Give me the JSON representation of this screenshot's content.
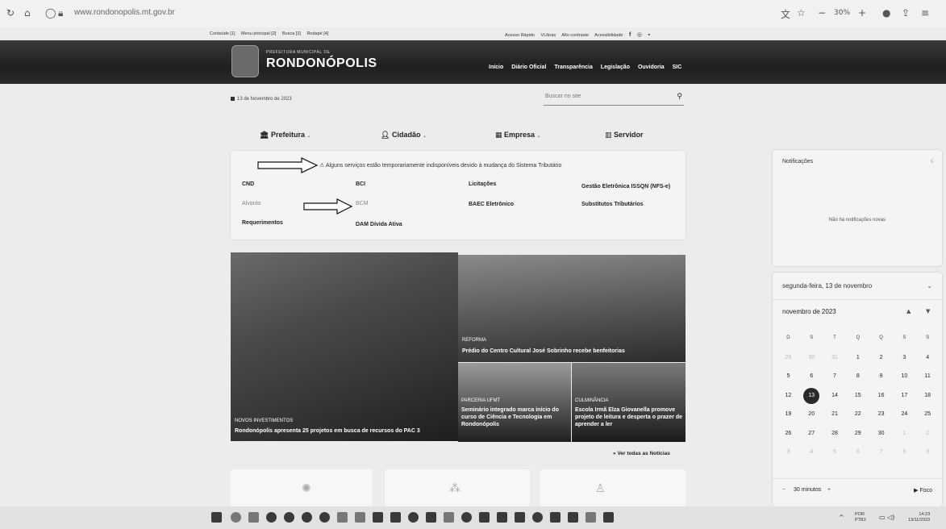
{
  "browser": {
    "url": "www.rondonopolis.mt.gov.br",
    "zoom": "30%",
    "minus": "−",
    "plus": "+"
  },
  "top_links": {
    "skip": [
      "Conteúdo [1]",
      "Menu principal [2]",
      "Busca [3]",
      "Rodapé [4]"
    ],
    "access": [
      "Acesso Rápido",
      "VLibras",
      "Alto contraste",
      "Acessibilidade"
    ]
  },
  "header": {
    "prefeitura_label": "PREFEITURA MUNICIPAL DE",
    "city_name": "RONDONÓPOLIS",
    "nav": [
      "Início",
      "Diário Oficial",
      "Transparência",
      "Legislação",
      "Ouvidoria",
      "SIC"
    ]
  },
  "date_text": "13 de Novembro de 2023",
  "search": {
    "placeholder": "Buscar no site"
  },
  "categories": [
    "Prefeitura",
    "Cidadão",
    "Empresa",
    "Servidor"
  ],
  "services": {
    "notice": "Alguns serviços estão temporariamente indisponíveis devido à mudança do Sistema Tributário",
    "items": [
      "CND",
      "BCI",
      "Licitações",
      "Gestão Eletrônica ISSQN (NFS-e)",
      "Alvarás",
      "BCM",
      "BAEC Eletrônico",
      "Substitutos Tributários",
      "Requerimentos",
      "DAM Dívida Ativa"
    ]
  },
  "news": [
    {
      "tag": "NOVOS INVESTIMENTOS",
      "headline": "Rondonópolis apresenta 25 projetos em busca de recursos do PAC 3"
    },
    {
      "tag": "REFORMA",
      "headline": "Prédio do Centro Cultural José Sobrinho recebe benfeitorias"
    },
    {
      "tag": "PARCERIA UFMT",
      "headline": "Seminário integrado marca início do curso de Ciência e Tecnologia em Rondonópolis"
    },
    {
      "tag": "CULMINÂNCIA",
      "headline": "Escola Irmã Elza Giovanella promove projeto de leitura e desperta o prazer de aprender a ler"
    }
  ],
  "see_all": "Ver todas as Notícias",
  "notifications": {
    "title": "Notificações",
    "empty": "Não há notificações novas"
  },
  "calendar": {
    "date_header": "segunda-feira, 13 de novembro",
    "month": "novembro de 2023",
    "weekdays": [
      "D",
      "S",
      "T",
      "Q",
      "Q",
      "S",
      "S"
    ],
    "weeks": [
      [
        "29",
        "30",
        "31",
        "1",
        "2",
        "3",
        "4"
      ],
      [
        "5",
        "6",
        "7",
        "8",
        "9",
        "10",
        "11"
      ],
      [
        "12",
        "13",
        "14",
        "15",
        "16",
        "17",
        "18"
      ],
      [
        "19",
        "20",
        "21",
        "22",
        "23",
        "24",
        "25"
      ],
      [
        "26",
        "27",
        "28",
        "29",
        "30",
        "1",
        "2"
      ],
      [
        "3",
        "4",
        "5",
        "6",
        "7",
        "8",
        "9"
      ]
    ],
    "today": "13",
    "focus_minus": "−",
    "focus_duration": "30 minutos",
    "focus_plus": "+",
    "focus_button": "Foco"
  },
  "taskbar": {
    "lang_line1": "POR",
    "lang_line2": "PTB2",
    "time": "14:23",
    "date": "13/11/2023"
  }
}
